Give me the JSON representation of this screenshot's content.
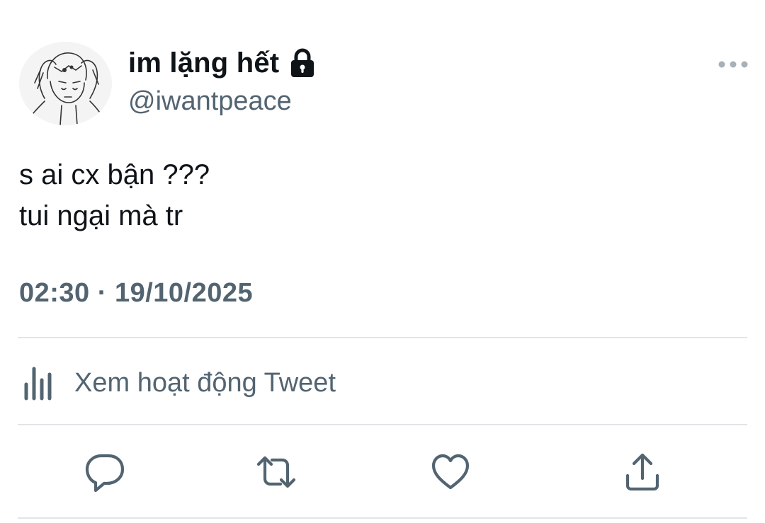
{
  "user": {
    "display_name": "im lặng hết",
    "handle": "@iwantpeace",
    "protected_icon": "lock-icon"
  },
  "tweet": {
    "lines": [
      "s ai cx bận ???",
      "tui ngại mà tr"
    ],
    "timestamp": "02:30 · 19/10/2025"
  },
  "activity": {
    "label": "Xem hoạt động Tweet",
    "icon": "analytics-icon"
  },
  "actions": [
    {
      "name": "reply",
      "icon": "reply-icon"
    },
    {
      "name": "retweet",
      "icon": "retweet-icon"
    },
    {
      "name": "like",
      "icon": "heart-icon"
    },
    {
      "name": "share",
      "icon": "share-icon"
    }
  ],
  "colors": {
    "text_primary": "#0f1419",
    "text_secondary": "#536471",
    "divider": "#e1e5e8"
  }
}
